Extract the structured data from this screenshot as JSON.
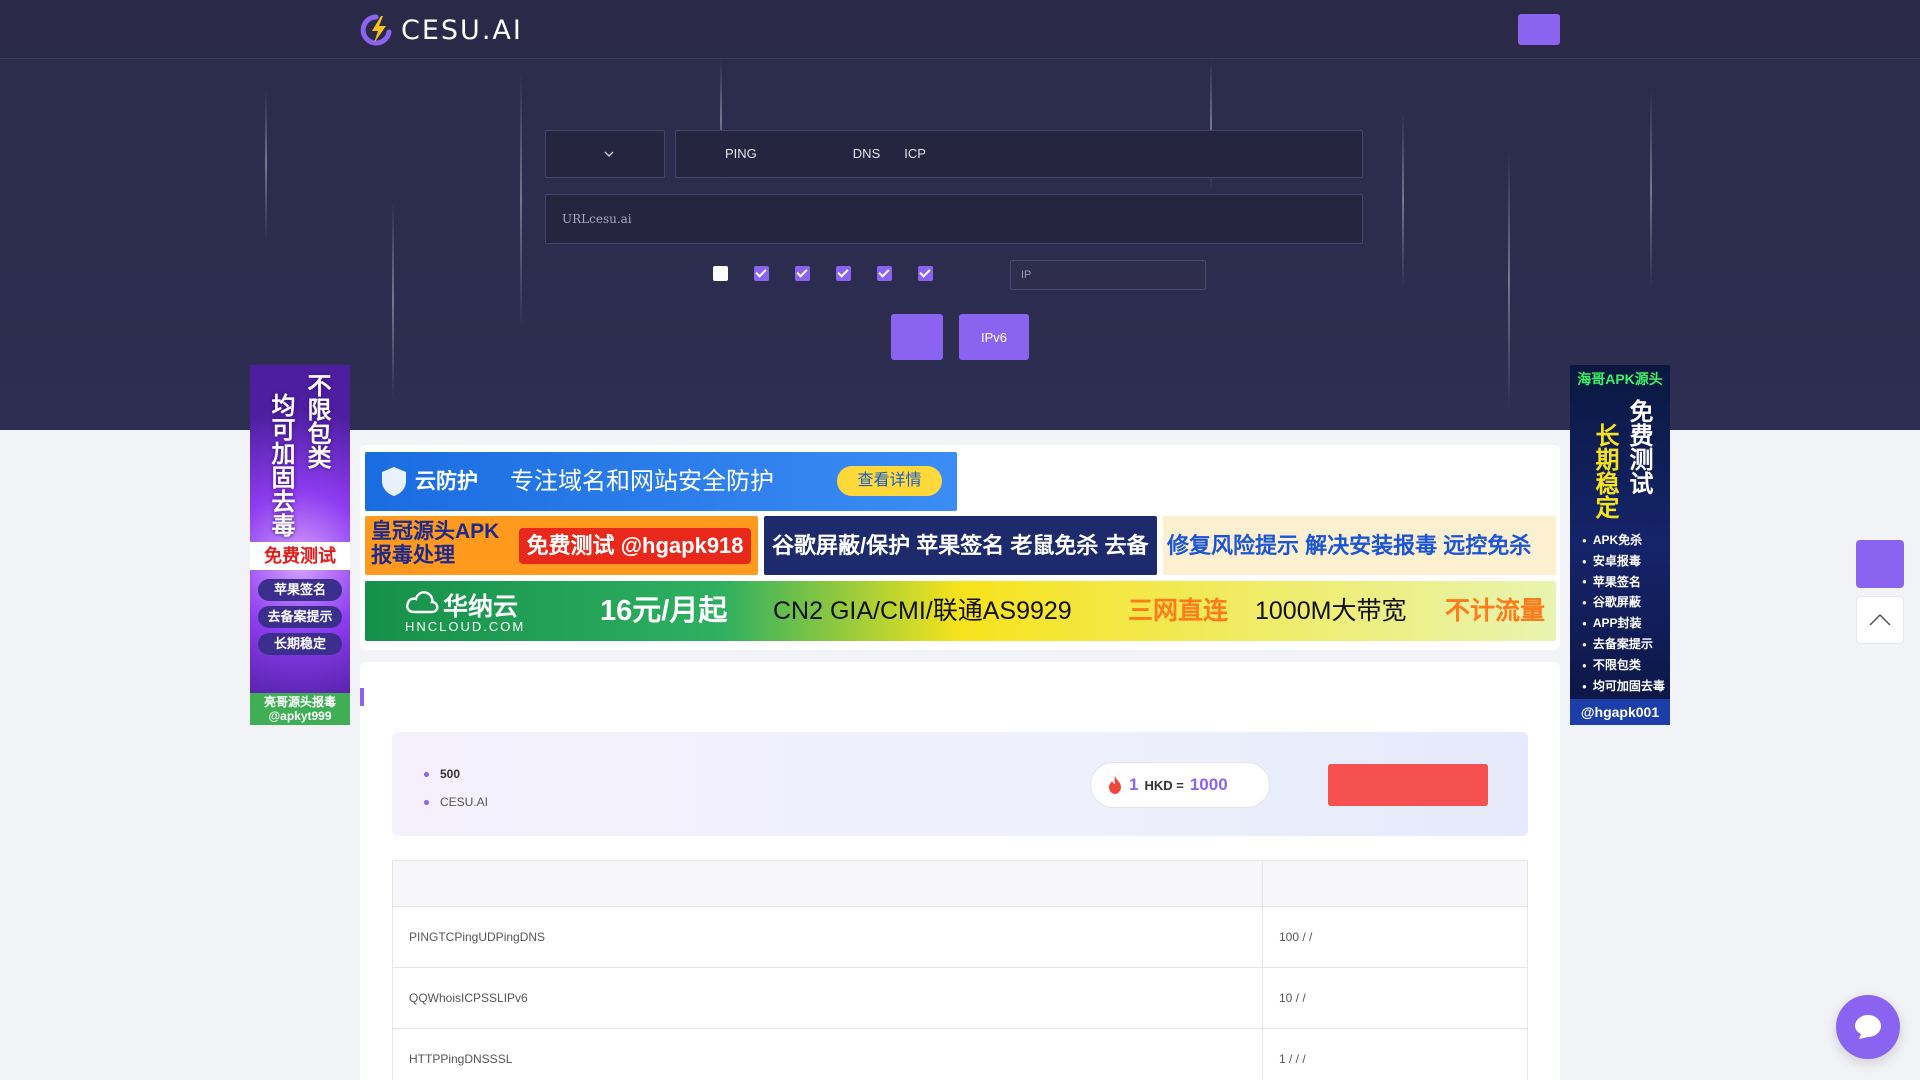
{
  "nav": {
    "logo_text": "CESU.AI",
    "links": [
      "",
      "",
      "",
      "",
      ""
    ],
    "login_label": "",
    "register_label": ""
  },
  "tool": {
    "region_label": "",
    "tabs": [
      "",
      "PING",
      "",
      "",
      "",
      "DNS",
      "ICP",
      ""
    ],
    "url_placeholder": "URLcesu.ai",
    "url_hint": "",
    "checks": [
      {
        "label": "",
        "checked": false
      },
      {
        "label": "",
        "checked": true
      },
      {
        "label": "",
        "checked": true
      },
      {
        "label": "",
        "checked": true
      },
      {
        "label": "",
        "checked": true
      },
      {
        "label": "",
        "checked": true
      }
    ],
    "ip_placeholder": "IP",
    "test_button": "",
    "ipv6_button": "IPv6"
  },
  "side_ads": {
    "left": {
      "headline_1": "不限包类",
      "headline_2": "均可加固去毒",
      "badge": "免费测试",
      "pills": [
        "苹果签名",
        "去备案提示",
        "长期稳定"
      ],
      "footer_1": "亮哥源头报毒",
      "footer_2": "@apkyt999",
      "mark": ""
    },
    "right": {
      "title": "海哥APK源头",
      "headline_1": "免费测试",
      "headline_2": "长期稳定",
      "items": [
        "APK免杀",
        "安卓报毒",
        "苹果签名",
        "谷歌屏蔽",
        "APP封装",
        "去备案提示",
        "不限包类",
        "均可加固去毒"
      ],
      "footer": "@hgapk001",
      "mark": ""
    }
  },
  "banners": {
    "b1": {
      "brand": "云防护",
      "slogan": "专注域名和网站安全防护",
      "cta": "查看详情"
    },
    "b2": {
      "line1": "皇冠源头APK",
      "line2": "报毒处理",
      "tag": "免费测试 @hgapk918"
    },
    "b3": {
      "text": "谷歌屏蔽/保护 苹果签名 老鼠免杀 去备案提示"
    },
    "b4": {
      "text": "修复风险提示 解决安装报毒 远控免杀 长期稳定"
    },
    "b5": {
      "brand": "华纳云",
      "domain": "HNCLOUD.COM",
      "price": "16元/月起",
      "spec": "CN2 GIA/CMI/联通AS9929",
      "tag1": "三网直连",
      "bw": "1000M大带宽",
      "tag2": "不计流量"
    },
    "mark": ""
  },
  "pricing": {
    "section_title": "",
    "bullets": [
      {
        "before": "",
        "strong": "500",
        "after": ""
      },
      {
        "before": " CESU.AI ",
        "strong": "",
        "after": ""
      }
    ],
    "rate": {
      "num1": "1",
      "unit": "HKD =",
      "num2": "1000",
      "desc": ""
    },
    "recharge_label": "",
    "table": {
      "headers": [
        "",
        ""
      ],
      "rows": [
        [
          "PINGTCPingUDPingDNS",
          "100 /  / "
        ],
        [
          "QQWhoisICPSSLIPv6",
          "10 /  / "
        ],
        [
          "HTTPPingDNSSSL",
          "1  /  /  / "
        ]
      ]
    }
  },
  "float": {
    "service_line1": "",
    "service_line2": ""
  }
}
